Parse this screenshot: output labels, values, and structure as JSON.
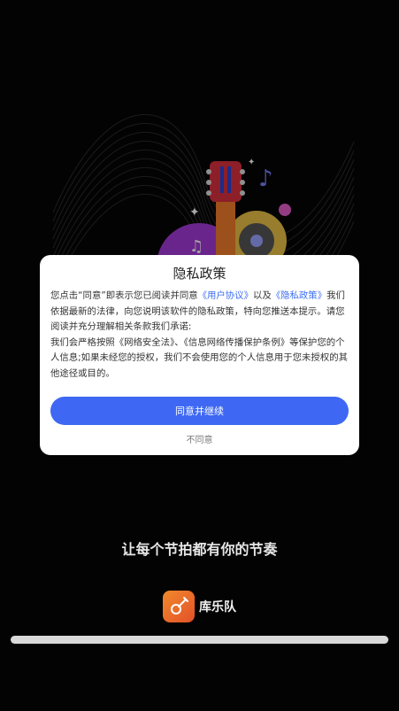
{
  "dialog": {
    "title": "隐私政策",
    "body": {
      "p1_a": "您点击“同意”即表示您已阅读并同意",
      "user_agreement": "《用户协议》",
      "p1_b": "以及",
      "privacy_policy": "《隐私政策》",
      "p1_c": "我们依据最新的法律，向您说明该软件的隐私政策，特向您推送本提示。请您阅读并充分理解相关条款我们承诺:",
      "p2": "我们会严格按照《网络安全法》、《信息网络传播保护条例》等保护您的个人信息;如果未经您的授权，我们不会使用您的个人信息用于您未授权的其他途径或目的。"
    },
    "agree_label": "同意并继续",
    "disagree_label": "不同意"
  },
  "slogan": "让每个节拍都有你的节奏",
  "app": {
    "name": "库乐队",
    "icon": "guitar-icon"
  },
  "colors": {
    "accent": "#3e68f3",
    "link": "#3d6ef2",
    "background": "#050505",
    "icon_gradient_start": "#f08a2b",
    "icon_gradient_end": "#e4502a"
  }
}
